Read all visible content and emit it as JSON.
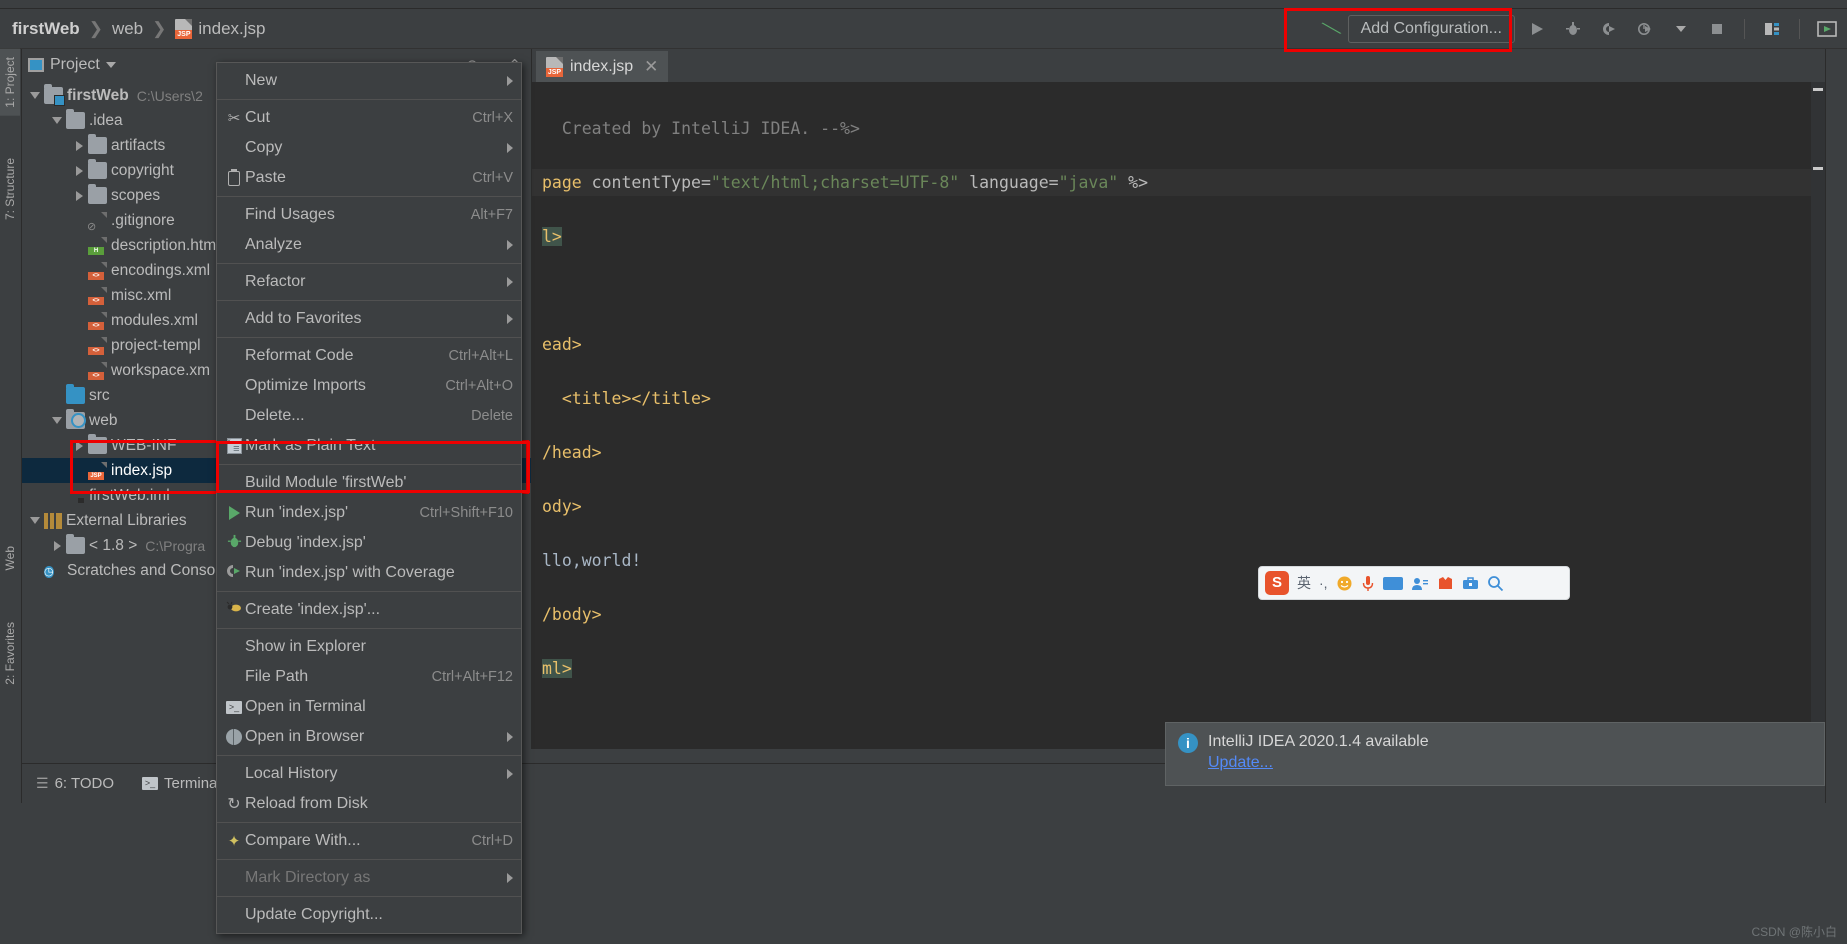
{
  "window": {
    "breadcrumbs": [
      {
        "label": "firstWeb",
        "bold": true
      },
      {
        "label": "web",
        "bold": false
      },
      {
        "label": "index.jsp",
        "bold": false,
        "icon": "jsp-file-icon"
      }
    ],
    "run_config_placeholder": "Add Configuration..."
  },
  "toolbar": {
    "hammer_icon": "build-hammer-icon",
    "icons": [
      {
        "name": "run-icon",
        "glyph": "▶"
      },
      {
        "name": "debug-icon",
        "glyph": "🐞"
      },
      {
        "name": "run-with-coverage-icon",
        "glyph": "◖▶"
      },
      {
        "name": "profile-icon",
        "glyph": "◷▶"
      },
      {
        "name": "profile-dropdown-icon",
        "glyph": "▾"
      },
      {
        "name": "stop-icon",
        "glyph": "■"
      },
      {
        "name": "search-everywhere-icon",
        "glyph": "⬓"
      },
      {
        "name": "preview-icon",
        "glyph": "▣"
      }
    ],
    "annotation_color": "#ee0000"
  },
  "stripes": {
    "left": [
      {
        "label": "1: Project",
        "active": true
      },
      {
        "label": "7: Structure",
        "active": false
      },
      {
        "label": "Web",
        "active": false
      },
      {
        "label": "2: Favorites",
        "active": false
      }
    ]
  },
  "project_panel": {
    "title": "Project",
    "tree": [
      {
        "depth": 0,
        "twisty": "down",
        "icon": "folder-module",
        "label": "firstWeb",
        "bold": true,
        "sub": "C:\\Users\\2",
        "selected": false
      },
      {
        "depth": 1,
        "twisty": "down",
        "icon": "folder",
        "label": ".idea",
        "bold": false,
        "sub": "",
        "selected": false
      },
      {
        "depth": 2,
        "twisty": "right",
        "icon": "folder",
        "label": "artifacts",
        "bold": false,
        "sub": "",
        "selected": false
      },
      {
        "depth": 2,
        "twisty": "right",
        "icon": "folder",
        "label": "copyright",
        "bold": false,
        "sub": "",
        "selected": false
      },
      {
        "depth": 2,
        "twisty": "right",
        "icon": "folder",
        "label": "scopes",
        "bold": false,
        "sub": "",
        "selected": false
      },
      {
        "depth": 2,
        "twisty": "none",
        "icon": "file-gitignore",
        "label": ".gitignore",
        "bold": false,
        "sub": "",
        "selected": false
      },
      {
        "depth": 2,
        "twisty": "none",
        "icon": "file-html",
        "label": "description.htm",
        "bold": false,
        "sub": "",
        "selected": false
      },
      {
        "depth": 2,
        "twisty": "none",
        "icon": "file-xml",
        "label": "encodings.xml",
        "bold": false,
        "sub": "",
        "selected": false
      },
      {
        "depth": 2,
        "twisty": "none",
        "icon": "file-xml",
        "label": "misc.xml",
        "bold": false,
        "sub": "",
        "selected": false
      },
      {
        "depth": 2,
        "twisty": "none",
        "icon": "file-xml",
        "label": "modules.xml",
        "bold": false,
        "sub": "",
        "selected": false
      },
      {
        "depth": 2,
        "twisty": "none",
        "icon": "file-xml",
        "label": "project-templ",
        "bold": false,
        "sub": "",
        "selected": false
      },
      {
        "depth": 2,
        "twisty": "none",
        "icon": "file-xml",
        "label": "workspace.xm",
        "bold": false,
        "sub": "",
        "selected": false
      },
      {
        "depth": 1,
        "twisty": "none",
        "icon": "folder-source",
        "label": "src",
        "bold": false,
        "sub": "",
        "selected": false
      },
      {
        "depth": 1,
        "twisty": "down",
        "icon": "folder-web",
        "label": "web",
        "bold": false,
        "sub": "",
        "selected": false
      },
      {
        "depth": 2,
        "twisty": "right",
        "icon": "folder",
        "label": "WEB-INF",
        "bold": false,
        "sub": "",
        "selected": false
      },
      {
        "depth": 2,
        "twisty": "none",
        "icon": "file-jsp",
        "label": "index.jsp",
        "bold": false,
        "sub": "",
        "selected": true
      },
      {
        "depth": 1,
        "twisty": "none",
        "icon": "file-iml",
        "label": "firstWeb.iml",
        "bold": false,
        "sub": "",
        "selected": false
      },
      {
        "depth": 0,
        "twisty": "down",
        "icon": "libraries",
        "label": "External Libraries",
        "bold": false,
        "sub": "",
        "selected": false
      },
      {
        "depth": 1,
        "twisty": "right",
        "icon": "folder-sdk",
        "label": "< 1.8 >",
        "bold": false,
        "sub": "C:\\Progra",
        "selected": false
      },
      {
        "depth": 0,
        "twisty": "none",
        "icon": "scratches",
        "label": "Scratches and Conso",
        "bold": false,
        "sub": "",
        "selected": false
      }
    ]
  },
  "context_menu": {
    "items": [
      {
        "label": "New",
        "icon": "",
        "shortcut": "",
        "submenu": true,
        "separator_after": true,
        "disabled": false
      },
      {
        "label": "Cut",
        "icon": "scissors-icon",
        "shortcut": "Ctrl+X",
        "submenu": false,
        "separator_after": false,
        "disabled": false
      },
      {
        "label": "Copy",
        "icon": "",
        "shortcut": "",
        "submenu": true,
        "separator_after": false,
        "disabled": false
      },
      {
        "label": "Paste",
        "icon": "clipboard-icon",
        "shortcut": "Ctrl+V",
        "submenu": false,
        "separator_after": true,
        "disabled": false
      },
      {
        "label": "Find Usages",
        "icon": "",
        "shortcut": "Alt+F7",
        "submenu": false,
        "separator_after": false,
        "disabled": false
      },
      {
        "label": "Analyze",
        "icon": "",
        "shortcut": "",
        "submenu": true,
        "separator_after": true,
        "disabled": false
      },
      {
        "label": "Refactor",
        "icon": "",
        "shortcut": "",
        "submenu": true,
        "separator_after": true,
        "disabled": false
      },
      {
        "label": "Add to Favorites",
        "icon": "",
        "shortcut": "",
        "submenu": true,
        "separator_after": true,
        "disabled": false
      },
      {
        "label": "Reformat Code",
        "icon": "",
        "shortcut": "Ctrl+Alt+L",
        "submenu": false,
        "separator_after": false,
        "disabled": false
      },
      {
        "label": "Optimize Imports",
        "icon": "",
        "shortcut": "Ctrl+Alt+O",
        "submenu": false,
        "separator_after": false,
        "disabled": false
      },
      {
        "label": "Delete...",
        "icon": "",
        "shortcut": "Delete",
        "submenu": false,
        "separator_after": false,
        "disabled": false
      },
      {
        "label": "Mark as Plain Text",
        "icon": "plain-text-icon",
        "shortcut": "",
        "submenu": false,
        "separator_after": true,
        "disabled": false
      },
      {
        "label": "Build Module 'firstWeb'",
        "icon": "",
        "shortcut": "",
        "submenu": false,
        "separator_after": false,
        "disabled": false
      },
      {
        "label": "Run 'index.jsp'",
        "icon": "run-icon",
        "shortcut": "Ctrl+Shift+F10",
        "submenu": false,
        "separator_after": false,
        "disabled": false
      },
      {
        "label": "Debug 'index.jsp'",
        "icon": "debug-icon",
        "shortcut": "",
        "submenu": false,
        "separator_after": false,
        "disabled": false
      },
      {
        "label": "Run 'index.jsp' with Coverage",
        "icon": "coverage-icon",
        "shortcut": "",
        "submenu": false,
        "separator_after": true,
        "disabled": false
      },
      {
        "label": "Create 'index.jsp'...",
        "icon": "ant-icon",
        "shortcut": "",
        "submenu": false,
        "separator_after": true,
        "disabled": false
      },
      {
        "label": "Show in Explorer",
        "icon": "",
        "shortcut": "",
        "submenu": false,
        "separator_after": false,
        "disabled": false
      },
      {
        "label": "File Path",
        "icon": "",
        "shortcut": "Ctrl+Alt+F12",
        "submenu": false,
        "separator_after": false,
        "disabled": false
      },
      {
        "label": "Open in Terminal",
        "icon": "terminal-icon",
        "shortcut": "",
        "submenu": false,
        "separator_after": false,
        "disabled": false
      },
      {
        "label": "Open in Browser",
        "icon": "globe-icon",
        "shortcut": "",
        "submenu": true,
        "separator_after": true,
        "disabled": false
      },
      {
        "label": "Local History",
        "icon": "",
        "shortcut": "",
        "submenu": true,
        "separator_after": false,
        "disabled": false
      },
      {
        "label": "Reload from Disk",
        "icon": "reload-icon",
        "shortcut": "",
        "submenu": false,
        "separator_after": true,
        "disabled": false
      },
      {
        "label": "Compare With...",
        "icon": "compare-icon",
        "shortcut": "Ctrl+D",
        "submenu": false,
        "separator_after": true,
        "disabled": false
      },
      {
        "label": "Mark Directory as",
        "icon": "",
        "shortcut": "",
        "submenu": true,
        "separator_after": true,
        "disabled": true
      },
      {
        "label": "Update Copyright...",
        "icon": "",
        "shortcut": "",
        "submenu": false,
        "separator_after": false,
        "disabled": false
      }
    ]
  },
  "editor": {
    "tab": {
      "label": "index.jsp",
      "icon": "jsp-file-icon",
      "close": "✕"
    },
    "lines": [
      {
        "text": "Created by IntelliJ IDEA. --%>",
        "kind": "comment"
      },
      {
        "text": "page contentType=\"text/html;charset=UTF-8\" language=\"java\" %>",
        "kind": "directive"
      },
      {
        "text": "l>",
        "kind": "tag-selected"
      },
      {
        "text": "",
        "kind": "blank"
      },
      {
        "text": "ead>",
        "kind": "tag"
      },
      {
        "text": "  <title></title>",
        "kind": "tag"
      },
      {
        "text": "/head>",
        "kind": "tag"
      },
      {
        "text": "ody>",
        "kind": "tag"
      },
      {
        "text": "llo,world!",
        "kind": "text"
      },
      {
        "text": "/body>",
        "kind": "tag"
      },
      {
        "text": "ml>",
        "kind": "tag"
      }
    ]
  },
  "notification": {
    "icon": "info-icon",
    "title": "IntelliJ IDEA 2020.1.4 available",
    "link": "Update..."
  },
  "ime_toolbar": {
    "logo": "S",
    "items": [
      {
        "name": "ime-mode-chinese",
        "glyph": "英"
      },
      {
        "name": "ime-punctuation",
        "glyph": "·,"
      },
      {
        "name": "ime-emoji",
        "glyph": "☺"
      },
      {
        "name": "ime-voice",
        "glyph": "🎤"
      },
      {
        "name": "ime-keyboard",
        "glyph": "⌨"
      },
      {
        "name": "ime-user",
        "glyph": "👤"
      },
      {
        "name": "ime-skin",
        "glyph": "👔"
      },
      {
        "name": "ime-toolbox",
        "glyph": "🧰"
      },
      {
        "name": "ime-search",
        "glyph": "🔍"
      }
    ]
  },
  "bottom_bar": {
    "items": [
      {
        "label": "6: TODO",
        "icon": "todo-icon"
      },
      {
        "label": "Terminal",
        "icon": "terminal-icon"
      }
    ]
  },
  "watermark": "CSDN @陈小白",
  "colors": {
    "accent": "#3592c4",
    "annotation": "#ee0000",
    "run_green": "#59a869",
    "selection": "#0d293e",
    "editor_bg": "#2b2b2b",
    "panel_bg": "#3c3f41"
  }
}
